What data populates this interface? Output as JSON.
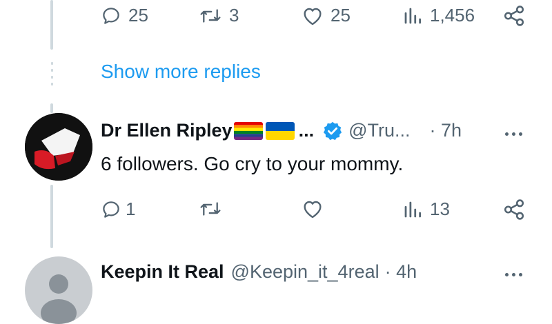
{
  "top_actions": {
    "replies": "25",
    "reposts": "3",
    "likes": "25",
    "views": "1,456"
  },
  "show_more_replies": "Show more replies",
  "reply1": {
    "name": "Dr Ellen Ripley",
    "name_ellipsis": "...",
    "handle": "@Tru...",
    "time": "· 7h",
    "text": "6 followers.  Go cry to your mommy.",
    "actions": {
      "replies": "1",
      "reposts": "",
      "likes": "",
      "views": "13"
    }
  },
  "reply2": {
    "name": "Keepin It Real",
    "handle": "@Keepin_it_4real",
    "time": "· 4h"
  },
  "colors": {
    "accent": "#1d9bf0",
    "muted": "#536471",
    "text": "#0f1419",
    "verified": "#1d9bf0",
    "thread_line": "#cfd9de"
  },
  "icons": [
    "reply-icon",
    "repost-icon",
    "like-icon",
    "views-icon",
    "share-icon",
    "verified-icon",
    "more-icon",
    "pride-flag-icon",
    "ukraine-flag-icon"
  ]
}
